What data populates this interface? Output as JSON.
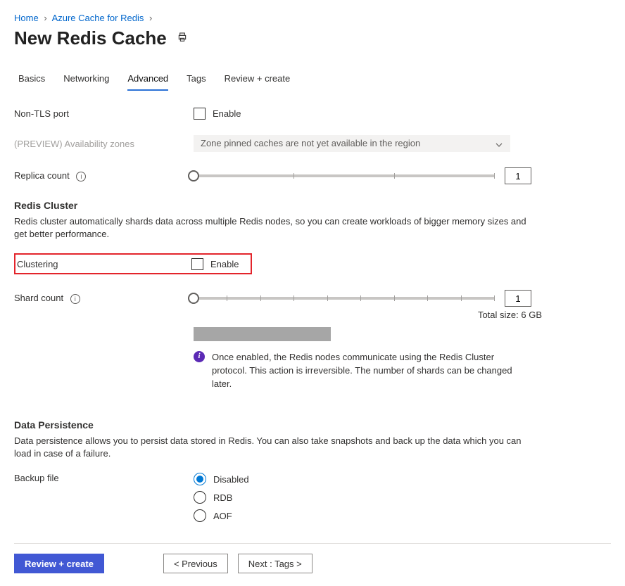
{
  "breadcrumb": {
    "home": "Home",
    "section": "Azure Cache for Redis"
  },
  "page_title": "New Redis Cache",
  "tabs": {
    "basics": "Basics",
    "networking": "Networking",
    "advanced": "Advanced",
    "tags": "Tags",
    "review": "Review + create"
  },
  "fields": {
    "non_tls_label": "Non-TLS port",
    "enable_label": "Enable",
    "az_label": "(PREVIEW) Availability zones",
    "az_placeholder": "Zone pinned caches are not yet available in the region",
    "replica_label": "Replica count",
    "replica_value": "1",
    "clustering_label": "Clustering",
    "shard_label": "Shard count",
    "shard_value": "1",
    "total_size": "Total size: 6 GB",
    "backup_label": "Backup file"
  },
  "sections": {
    "cluster_title": "Redis Cluster",
    "cluster_desc": "Redis cluster automatically shards data across multiple Redis nodes, so you can create workloads of bigger memory sizes and get better performance.",
    "cluster_note": "Once enabled, the Redis nodes communicate using the Redis Cluster protocol. This action is irreversible. The number of shards can be changed later.",
    "persist_title": "Data Persistence",
    "persist_desc": "Data persistence allows you to persist data stored in Redis. You can also take snapshots and back up the data which you can load in case of a failure."
  },
  "radio": {
    "disabled": "Disabled",
    "rdb": "RDB",
    "aof": "AOF"
  },
  "footer": {
    "review": "Review + create",
    "previous": "<  Previous",
    "next": "Next : Tags  >"
  }
}
